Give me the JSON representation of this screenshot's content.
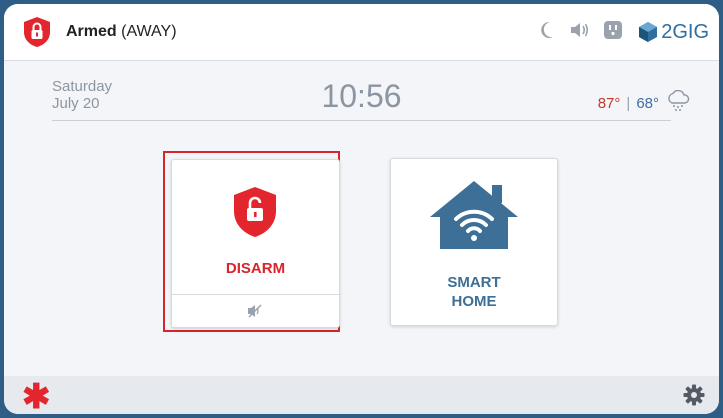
{
  "status": {
    "state": "Armed",
    "mode": "(AWAY)"
  },
  "topbar": {
    "icons": [
      "moon-icon",
      "speaker-icon",
      "outlet-icon"
    ],
    "brand": "2GIG"
  },
  "info": {
    "day": "Saturday",
    "date": "July 20",
    "time": "10:56",
    "temp_high": "87°",
    "temp_sep": "|",
    "temp_low": "68°",
    "weather_icon": "snow-cloud-icon"
  },
  "tiles": {
    "disarm": {
      "label": "DISARM",
      "icon": "shield-unlock-icon",
      "sub_icon": "mute-icon"
    },
    "smart_home": {
      "label_line1": "SMART",
      "label_line2": "HOME",
      "icon": "house-wifi-icon"
    }
  },
  "bottombar": {
    "left_icon": "asterisk-icon",
    "right_icon": "gear-icon"
  },
  "colors": {
    "accent_red": "#d9242c",
    "brand_blue": "#2f6e9d",
    "frame": "#2e5e85"
  }
}
